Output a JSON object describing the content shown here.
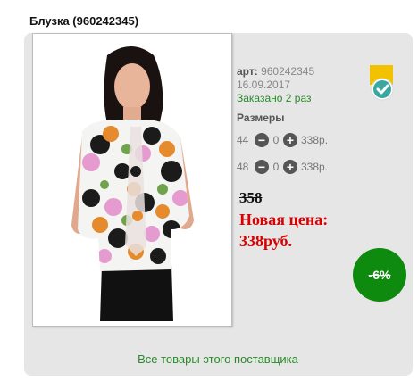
{
  "product": {
    "title": "Блузка (960242345)",
    "article_label": "арт:",
    "article": "960242345",
    "date": "16.09.2017",
    "ordered": "Заказано 2 раз"
  },
  "sizes": {
    "label": "Размеры",
    "rows": [
      {
        "size": "44",
        "qty": "0",
        "price": "338р."
      },
      {
        "size": "48",
        "qty": "0",
        "price": "338р."
      }
    ]
  },
  "pricing": {
    "old_price": "358",
    "new_price_label": "Новая цена:",
    "new_price": "338руб.",
    "discount": "-6%"
  },
  "footer": {
    "supplier_link": "Все товары этого поставщика"
  },
  "icons": {
    "minus": "minus-icon",
    "plus": "plus-icon",
    "badge": "verified-check-icon"
  },
  "colors": {
    "discount_bg": "#0e8a0e",
    "new_price": "#d80000",
    "ordered": "#2a8a2a",
    "badge_tag": "#f2c200",
    "badge_check": "#3aa8a0"
  }
}
